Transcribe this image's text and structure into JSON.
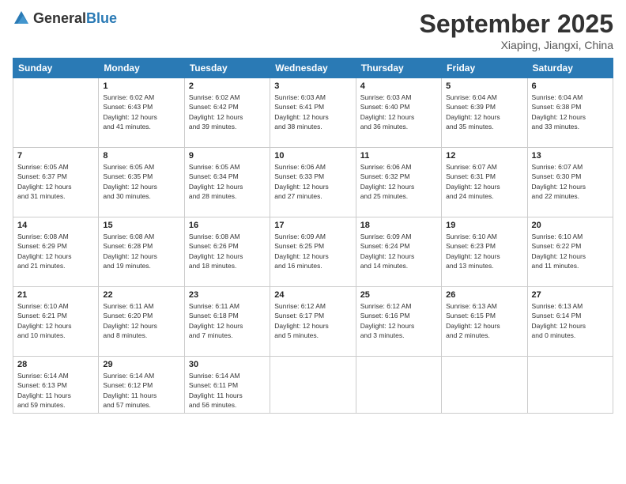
{
  "header": {
    "logo_general": "General",
    "logo_blue": "Blue",
    "month_title": "September 2025",
    "location": "Xiaping, Jiangxi, China"
  },
  "weekdays": [
    "Sunday",
    "Monday",
    "Tuesday",
    "Wednesday",
    "Thursday",
    "Friday",
    "Saturday"
  ],
  "weeks": [
    [
      {
        "day": "",
        "info": ""
      },
      {
        "day": "1",
        "info": "Sunrise: 6:02 AM\nSunset: 6:43 PM\nDaylight: 12 hours\nand 41 minutes."
      },
      {
        "day": "2",
        "info": "Sunrise: 6:02 AM\nSunset: 6:42 PM\nDaylight: 12 hours\nand 39 minutes."
      },
      {
        "day": "3",
        "info": "Sunrise: 6:03 AM\nSunset: 6:41 PM\nDaylight: 12 hours\nand 38 minutes."
      },
      {
        "day": "4",
        "info": "Sunrise: 6:03 AM\nSunset: 6:40 PM\nDaylight: 12 hours\nand 36 minutes."
      },
      {
        "day": "5",
        "info": "Sunrise: 6:04 AM\nSunset: 6:39 PM\nDaylight: 12 hours\nand 35 minutes."
      },
      {
        "day": "6",
        "info": "Sunrise: 6:04 AM\nSunset: 6:38 PM\nDaylight: 12 hours\nand 33 minutes."
      }
    ],
    [
      {
        "day": "7",
        "info": "Sunrise: 6:05 AM\nSunset: 6:37 PM\nDaylight: 12 hours\nand 31 minutes."
      },
      {
        "day": "8",
        "info": "Sunrise: 6:05 AM\nSunset: 6:35 PM\nDaylight: 12 hours\nand 30 minutes."
      },
      {
        "day": "9",
        "info": "Sunrise: 6:05 AM\nSunset: 6:34 PM\nDaylight: 12 hours\nand 28 minutes."
      },
      {
        "day": "10",
        "info": "Sunrise: 6:06 AM\nSunset: 6:33 PM\nDaylight: 12 hours\nand 27 minutes."
      },
      {
        "day": "11",
        "info": "Sunrise: 6:06 AM\nSunset: 6:32 PM\nDaylight: 12 hours\nand 25 minutes."
      },
      {
        "day": "12",
        "info": "Sunrise: 6:07 AM\nSunset: 6:31 PM\nDaylight: 12 hours\nand 24 minutes."
      },
      {
        "day": "13",
        "info": "Sunrise: 6:07 AM\nSunset: 6:30 PM\nDaylight: 12 hours\nand 22 minutes."
      }
    ],
    [
      {
        "day": "14",
        "info": "Sunrise: 6:08 AM\nSunset: 6:29 PM\nDaylight: 12 hours\nand 21 minutes."
      },
      {
        "day": "15",
        "info": "Sunrise: 6:08 AM\nSunset: 6:28 PM\nDaylight: 12 hours\nand 19 minutes."
      },
      {
        "day": "16",
        "info": "Sunrise: 6:08 AM\nSunset: 6:26 PM\nDaylight: 12 hours\nand 18 minutes."
      },
      {
        "day": "17",
        "info": "Sunrise: 6:09 AM\nSunset: 6:25 PM\nDaylight: 12 hours\nand 16 minutes."
      },
      {
        "day": "18",
        "info": "Sunrise: 6:09 AM\nSunset: 6:24 PM\nDaylight: 12 hours\nand 14 minutes."
      },
      {
        "day": "19",
        "info": "Sunrise: 6:10 AM\nSunset: 6:23 PM\nDaylight: 12 hours\nand 13 minutes."
      },
      {
        "day": "20",
        "info": "Sunrise: 6:10 AM\nSunset: 6:22 PM\nDaylight: 12 hours\nand 11 minutes."
      }
    ],
    [
      {
        "day": "21",
        "info": "Sunrise: 6:10 AM\nSunset: 6:21 PM\nDaylight: 12 hours\nand 10 minutes."
      },
      {
        "day": "22",
        "info": "Sunrise: 6:11 AM\nSunset: 6:20 PM\nDaylight: 12 hours\nand 8 minutes."
      },
      {
        "day": "23",
        "info": "Sunrise: 6:11 AM\nSunset: 6:18 PM\nDaylight: 12 hours\nand 7 minutes."
      },
      {
        "day": "24",
        "info": "Sunrise: 6:12 AM\nSunset: 6:17 PM\nDaylight: 12 hours\nand 5 minutes."
      },
      {
        "day": "25",
        "info": "Sunrise: 6:12 AM\nSunset: 6:16 PM\nDaylight: 12 hours\nand 3 minutes."
      },
      {
        "day": "26",
        "info": "Sunrise: 6:13 AM\nSunset: 6:15 PM\nDaylight: 12 hours\nand 2 minutes."
      },
      {
        "day": "27",
        "info": "Sunrise: 6:13 AM\nSunset: 6:14 PM\nDaylight: 12 hours\nand 0 minutes."
      }
    ],
    [
      {
        "day": "28",
        "info": "Sunrise: 6:14 AM\nSunset: 6:13 PM\nDaylight: 11 hours\nand 59 minutes."
      },
      {
        "day": "29",
        "info": "Sunrise: 6:14 AM\nSunset: 6:12 PM\nDaylight: 11 hours\nand 57 minutes."
      },
      {
        "day": "30",
        "info": "Sunrise: 6:14 AM\nSunset: 6:11 PM\nDaylight: 11 hours\nand 56 minutes."
      },
      {
        "day": "",
        "info": ""
      },
      {
        "day": "",
        "info": ""
      },
      {
        "day": "",
        "info": ""
      },
      {
        "day": "",
        "info": ""
      }
    ]
  ]
}
